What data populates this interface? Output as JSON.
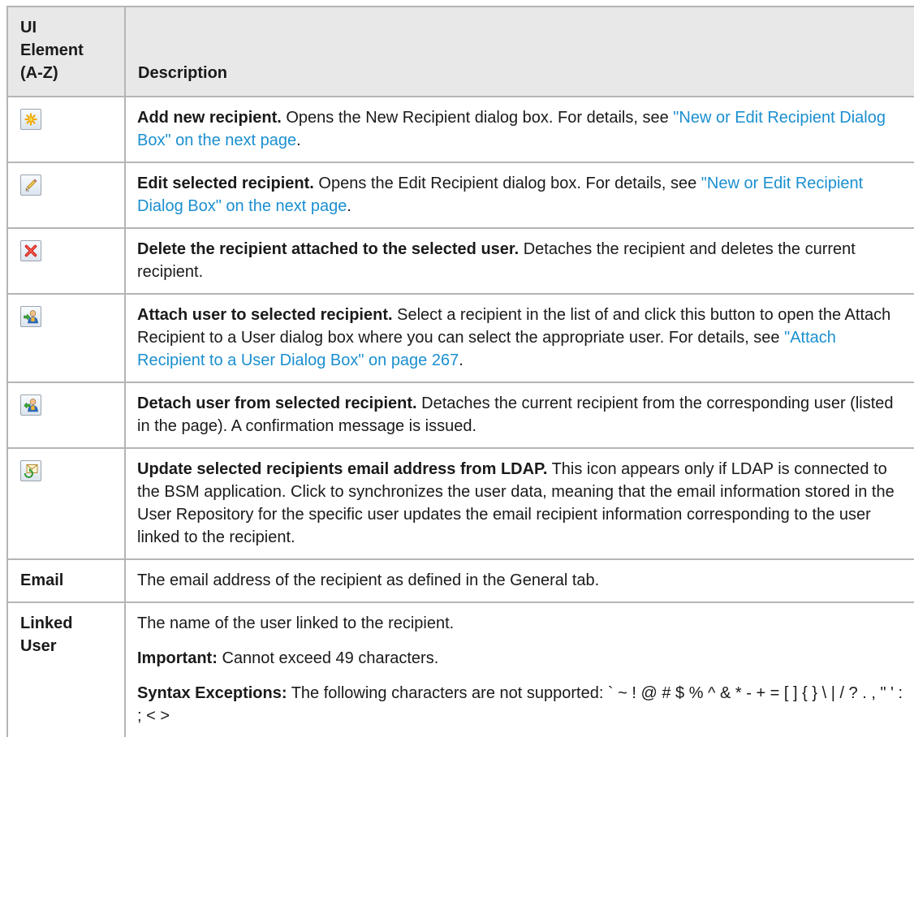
{
  "table": {
    "header": {
      "element_col": [
        "UI",
        "Element",
        "(A-Z)"
      ],
      "description_col": "Description"
    },
    "rows": [
      {
        "icon": "add-new-recipient-icon",
        "title": "Add new recipient.",
        "text": " Opens the New Recipient dialog box. For details, see ",
        "link": "\"New or Edit Recipient Dialog Box\" on the next page",
        "tail": "."
      },
      {
        "icon": "edit-recipient-icon",
        "title": "Edit selected recipient.",
        "text": " Opens the Edit Recipient dialog box. For details, see ",
        "link": "\"New or Edit Recipient Dialog Box\" on the next page",
        "tail": "."
      },
      {
        "icon": "delete-recipient-icon",
        "title": "Delete the recipient attached to the selected user.",
        "text": " Detaches the recipient and deletes the current recipient."
      },
      {
        "icon": "attach-user-icon",
        "title": "Attach user to selected recipient.",
        "text": " Select a recipient in the list of and click this button to open the Attach Recipient to a User dialog box where you can select the appropriate user. For details, see ",
        "link": "\"Attach Recipient to a User Dialog Box\" on page 267",
        "tail": "."
      },
      {
        "icon": "detach-user-icon",
        "title": "Detach user from selected recipient.",
        "text": " Detaches the current recipient from the corresponding user (listed in the page). A confirmation message is issued."
      },
      {
        "icon": "ldap-update-email-icon",
        "title": "Update selected recipients email address from LDAP.",
        "text": " This icon appears only if LDAP is connected to the BSM application. Click to synchronizes the user data, meaning that the email information stored in the User Repository for the specific user updates the email recipient information corresponding to the user linked to the recipient."
      },
      {
        "element": "Email",
        "text": "The email address of the recipient as defined in the General tab."
      },
      {
        "element_lines": [
          "Linked",
          "User"
        ],
        "text": "The name of the user linked to the recipient.",
        "important_label": "Important:",
        "important_text": " Cannot exceed 49 characters.",
        "syntax_label": "Syntax Exceptions:",
        "syntax_text": " The following characters are not supported: ` ~ ! @ # $ % ^ & * - + = [ ] { } \\ | / ? . , \" ' : ; < >"
      }
    ]
  },
  "colors": {
    "link": "#1b8fcf",
    "header_bg": "#e8e8e8",
    "border": "#b5b5b5"
  }
}
